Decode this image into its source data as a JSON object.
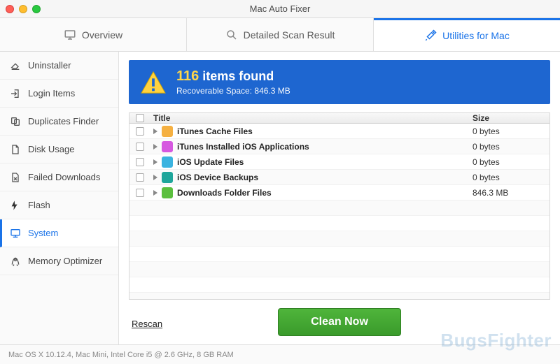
{
  "window": {
    "title": "Mac Auto Fixer"
  },
  "toptabs": {
    "overview": "Overview",
    "detailed": "Detailed Scan Result",
    "utilities": "Utilities for Mac"
  },
  "sidebar": {
    "uninstaller": "Uninstaller",
    "login_items": "Login Items",
    "duplicates": "Duplicates Finder",
    "disk_usage": "Disk Usage",
    "failed_downloads": "Failed Downloads",
    "flash": "Flash",
    "system": "System",
    "memory_optimizer": "Memory Optimizer"
  },
  "summary": {
    "count": "116",
    "count_suffix": "items found",
    "sub_prefix": "Recoverable Space: ",
    "sub_value": "846.3 MB"
  },
  "table": {
    "headers": {
      "title": "Title",
      "size": "Size"
    },
    "rows": [
      {
        "title": "iTunes Cache Files",
        "size": "0 bytes",
        "icon_color": "#f5b041"
      },
      {
        "title": "iTunes Installed iOS Applications",
        "size": "0 bytes",
        "icon_color": "#d658e0"
      },
      {
        "title": "iOS Update Files",
        "size": "0 bytes",
        "icon_color": "#3ab3e0"
      },
      {
        "title": "iOS Device Backups",
        "size": "0 bytes",
        "icon_color": "#1fa69b"
      },
      {
        "title": "Downloads Folder Files",
        "size": "846.3 MB",
        "icon_color": "#5bbf3e"
      }
    ]
  },
  "actions": {
    "rescan": "Rescan",
    "clean": "Clean Now"
  },
  "statusbar": {
    "text": "Mac OS X 10.12.4, Mac Mini, Intel Core i5 @ 2.6 GHz, 8 GB RAM"
  },
  "watermark": "BugsFighter"
}
